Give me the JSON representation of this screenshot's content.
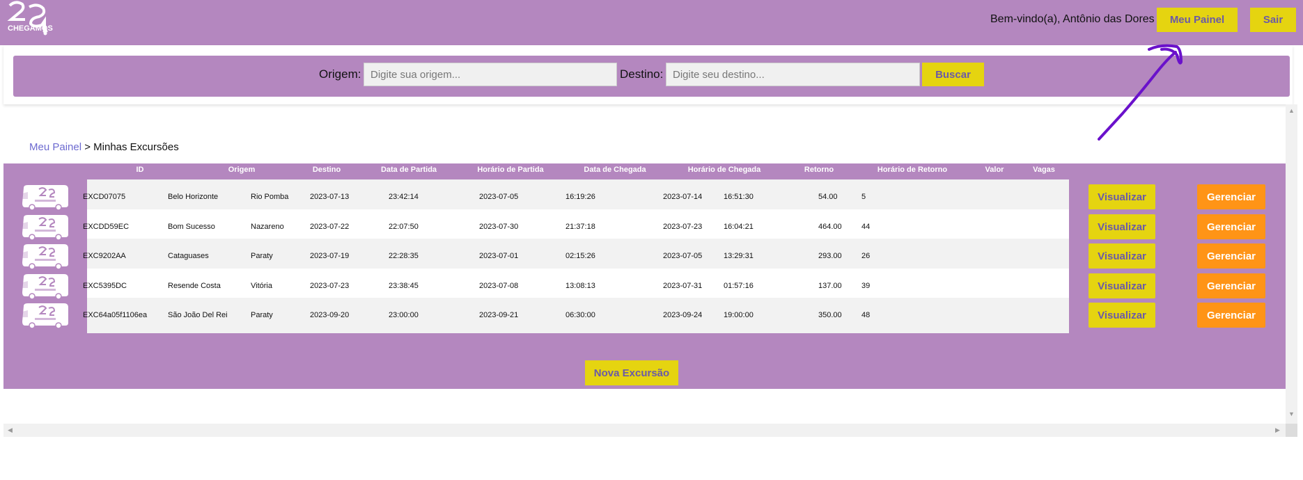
{
  "header": {
    "logo_text": "CHEGAMOS",
    "welcome": "Bem-vindo(a), Antônio das Dores",
    "panel_button": "Meu Painel",
    "exit_button": "Sair",
    "bg_color": "#b487bf"
  },
  "search": {
    "origin_label": "Origem:",
    "origin_placeholder": "Digite sua origem...",
    "destination_label": "Destino:",
    "destination_placeholder": "Digite seu destino...",
    "search_button": "Buscar"
  },
  "breadcrumb": {
    "link": "Meu Painel",
    "separator": " > ",
    "current": "Minhas Excursões"
  },
  "table": {
    "headers": [
      "ID",
      "Origem",
      "Destino",
      "Data de Partida",
      "Horário de Partida",
      "Data de Chegada",
      "Horário de Chegada",
      "Retorno",
      "Horário de Retorno",
      "Valor",
      "Vagas"
    ],
    "rows": [
      {
        "id": "EXCD07075",
        "origem": "Belo Horizonte",
        "destino": "Rio Pomba",
        "data_partida": "2023-07-13",
        "horario_partida": "23:42:14",
        "data_chegada": "2023-07-05",
        "horario_chegada": "16:19:26",
        "retorno": "2023-07-14",
        "horario_retorno": "16:51:30",
        "valor": "54.00",
        "vagas": "5"
      },
      {
        "id": "EXCDD59EC",
        "origem": "Bom Sucesso",
        "destino": "Nazareno",
        "data_partida": "2023-07-22",
        "horario_partida": "22:07:50",
        "data_chegada": "2023-07-30",
        "horario_chegada": "21:37:18",
        "retorno": "2023-07-23",
        "horario_retorno": "16:04:21",
        "valor": "464.00",
        "vagas": "44"
      },
      {
        "id": "EXC9202AA",
        "origem": "Cataguases",
        "destino": "Paraty",
        "data_partida": "2023-07-19",
        "horario_partida": "22:28:35",
        "data_chegada": "2023-07-01",
        "horario_chegada": "02:15:26",
        "retorno": "2023-07-05",
        "horario_retorno": "13:29:31",
        "valor": "293.00",
        "vagas": "26"
      },
      {
        "id": "EXC5395DC",
        "origem": "Resende Costa",
        "destino": "Vitória",
        "data_partida": "2023-07-23",
        "horario_partida": "23:38:45",
        "data_chegada": "2023-07-08",
        "horario_chegada": "13:08:13",
        "retorno": "2023-07-31",
        "horario_retorno": "01:57:16",
        "valor": "137.00",
        "vagas": "39"
      },
      {
        "id": "EXC64a05f1106ea",
        "origem": "São João Del Rei",
        "destino": "Paraty",
        "data_partida": "2023-09-20",
        "horario_partida": "23:00:00",
        "data_chegada": "2023-09-21",
        "horario_chegada": "06:30:00",
        "retorno": "2023-09-24",
        "horario_retorno": "19:00:00",
        "valor": "350.00",
        "vagas": "48"
      }
    ],
    "view_button": "Visualizar",
    "manage_button": "Gerenciar",
    "new_button": "Nova Excursão"
  },
  "colors": {
    "purple": "#b487bf",
    "yellow": "#e5d410",
    "orange": "#ff9416",
    "annotation": "#6a11cb"
  }
}
